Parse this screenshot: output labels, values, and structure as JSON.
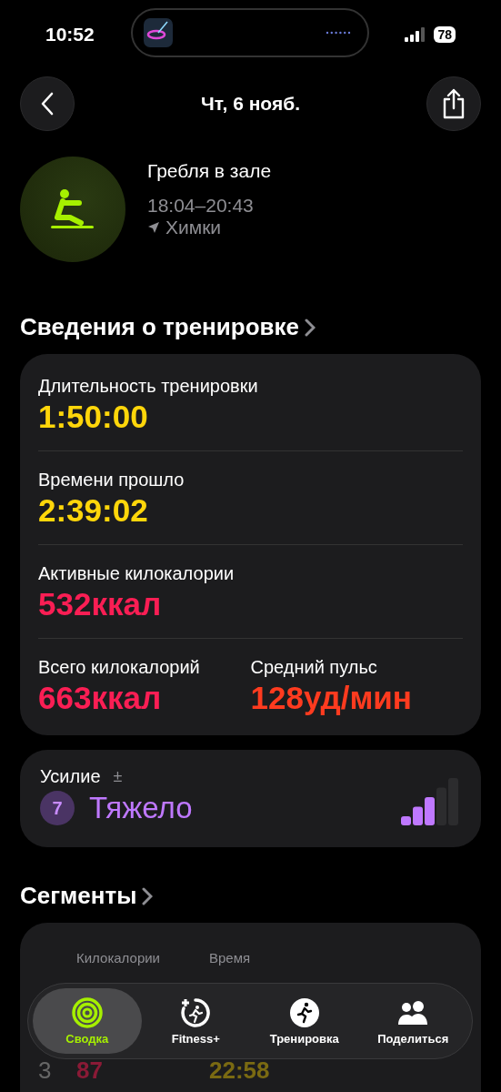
{
  "status_bar": {
    "time": "10:52",
    "battery": "78"
  },
  "header": {
    "title": "Чт, 6 нояб."
  },
  "workout": {
    "name": "Гребля в зале",
    "time_range": "18:04–20:43",
    "location": "Химки"
  },
  "details": {
    "title": "Сведения о тренировке",
    "rows": [
      [
        {
          "label": "Длительность тренировки",
          "value": "1:50:00",
          "color": "#ffd60a"
        }
      ],
      [
        {
          "label": "Времени прошло",
          "value": "2:39:02",
          "color": "#ffd60a"
        }
      ],
      [
        {
          "label": "Активные килокалории",
          "value": "532ккал",
          "color": "#fa1e54"
        }
      ],
      [
        {
          "label": "Всего килокалорий",
          "value": "663ккал",
          "color": "#fa1e54"
        },
        {
          "label": "Средний пульс",
          "value": "128уд/мин",
          "color": "#ff3b1f"
        }
      ]
    ]
  },
  "effort": {
    "label": "Усилие",
    "adjust": "±",
    "score": "7",
    "rating": "Тяжело",
    "level": 0.6
  },
  "segments": {
    "title": "Сегменты",
    "columns": [
      "Килокалории",
      "Время"
    ],
    "rows": [
      {
        "index": "3",
        "kcal": "87",
        "time": "22:58"
      }
    ]
  },
  "tab_bar": [
    {
      "label": "Сводка",
      "kind": "rings",
      "selected": true
    },
    {
      "label": "Fitness+",
      "kind": "fitness",
      "selected": false
    },
    {
      "label": "Тренировка",
      "kind": "run",
      "selected": false
    },
    {
      "label": "Поделиться",
      "kind": "people",
      "selected": false
    }
  ]
}
